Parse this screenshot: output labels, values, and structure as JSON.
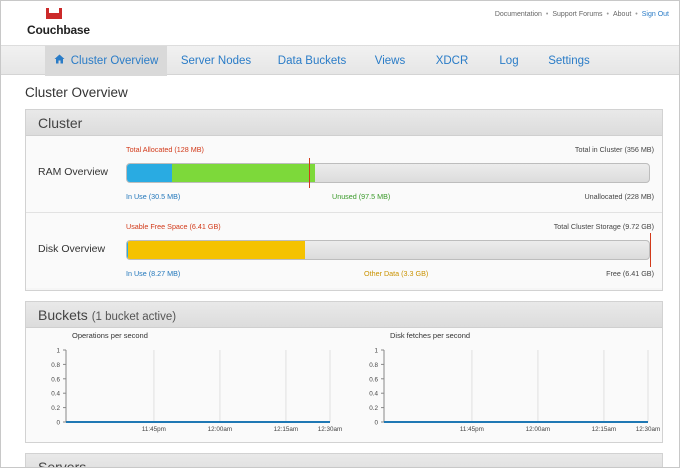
{
  "header": {
    "brand": "Couchbase",
    "links": [
      {
        "label": "Documentation"
      },
      {
        "label": "Support Forums"
      },
      {
        "label": "About"
      },
      {
        "label": "Sign Out"
      }
    ],
    "separator": "•",
    "brand_color": "#cc2a2a",
    "link_color": "#2a7cc7"
  },
  "nav": {
    "tabs": [
      {
        "label": "Cluster Overview",
        "active": true
      },
      {
        "label": "Server Nodes"
      },
      {
        "label": "Data Buckets"
      },
      {
        "label": "Views"
      },
      {
        "label": "XDCR"
      },
      {
        "label": "Log"
      },
      {
        "label": "Settings"
      }
    ]
  },
  "page": {
    "title": "Cluster Overview"
  },
  "cluster": {
    "heading": "Cluster",
    "ram": {
      "label": "RAM Overview",
      "total_allocated": "Total Allocated (128 MB)",
      "total_in_cluster": "Total in Cluster (356 MB)",
      "in_use": "In Use (30.5 MB)",
      "unused": "Unused (97.5 MB)",
      "unallocated": "Unallocated (228 MB)",
      "in_use_fraction": 0.0857,
      "unused_fraction": 0.2739
    },
    "disk": {
      "label": "Disk Overview",
      "usable_free": "Usable Free Space (6.41 GB)",
      "total_storage": "Total Cluster Storage (9.72 GB)",
      "in_use": "In Use (8.27 MB)",
      "other_data": "Other Data (3.3 GB)",
      "free": "Free (6.41 GB)",
      "in_use_fraction": 0.0008,
      "other_data_fraction": 0.34
    },
    "colors": {
      "in_use": "#29abe2",
      "unused": "#7dd93a",
      "other_data": "#f5c200",
      "marker": "#d23a1a"
    }
  },
  "buckets": {
    "heading": "Buckets",
    "sub": "(1 bucket active)"
  },
  "servers": {
    "heading": "Servers"
  },
  "chart_data": [
    {
      "type": "line",
      "title": "Operations per second",
      "x": [
        "11:45pm",
        "12:00am",
        "12:15am",
        "12:30am"
      ],
      "yticks": [
        "1",
        "0.8",
        "0.6",
        "0.4",
        "0.2",
        "0"
      ],
      "ylim": [
        0,
        1
      ],
      "series": [
        {
          "values": [
            0,
            0,
            0,
            0
          ]
        }
      ],
      "grid": true
    },
    {
      "type": "line",
      "title": "Disk fetches per second",
      "x": [
        "11:45pm",
        "12:00am",
        "12:15am",
        "12:30am"
      ],
      "yticks": [
        "1",
        "0.8",
        "0.6",
        "0.4",
        "0.2",
        "0"
      ],
      "ylim": [
        0,
        1
      ],
      "series": [
        {
          "values": [
            0,
            0,
            0,
            0
          ]
        }
      ],
      "grid": true
    }
  ]
}
